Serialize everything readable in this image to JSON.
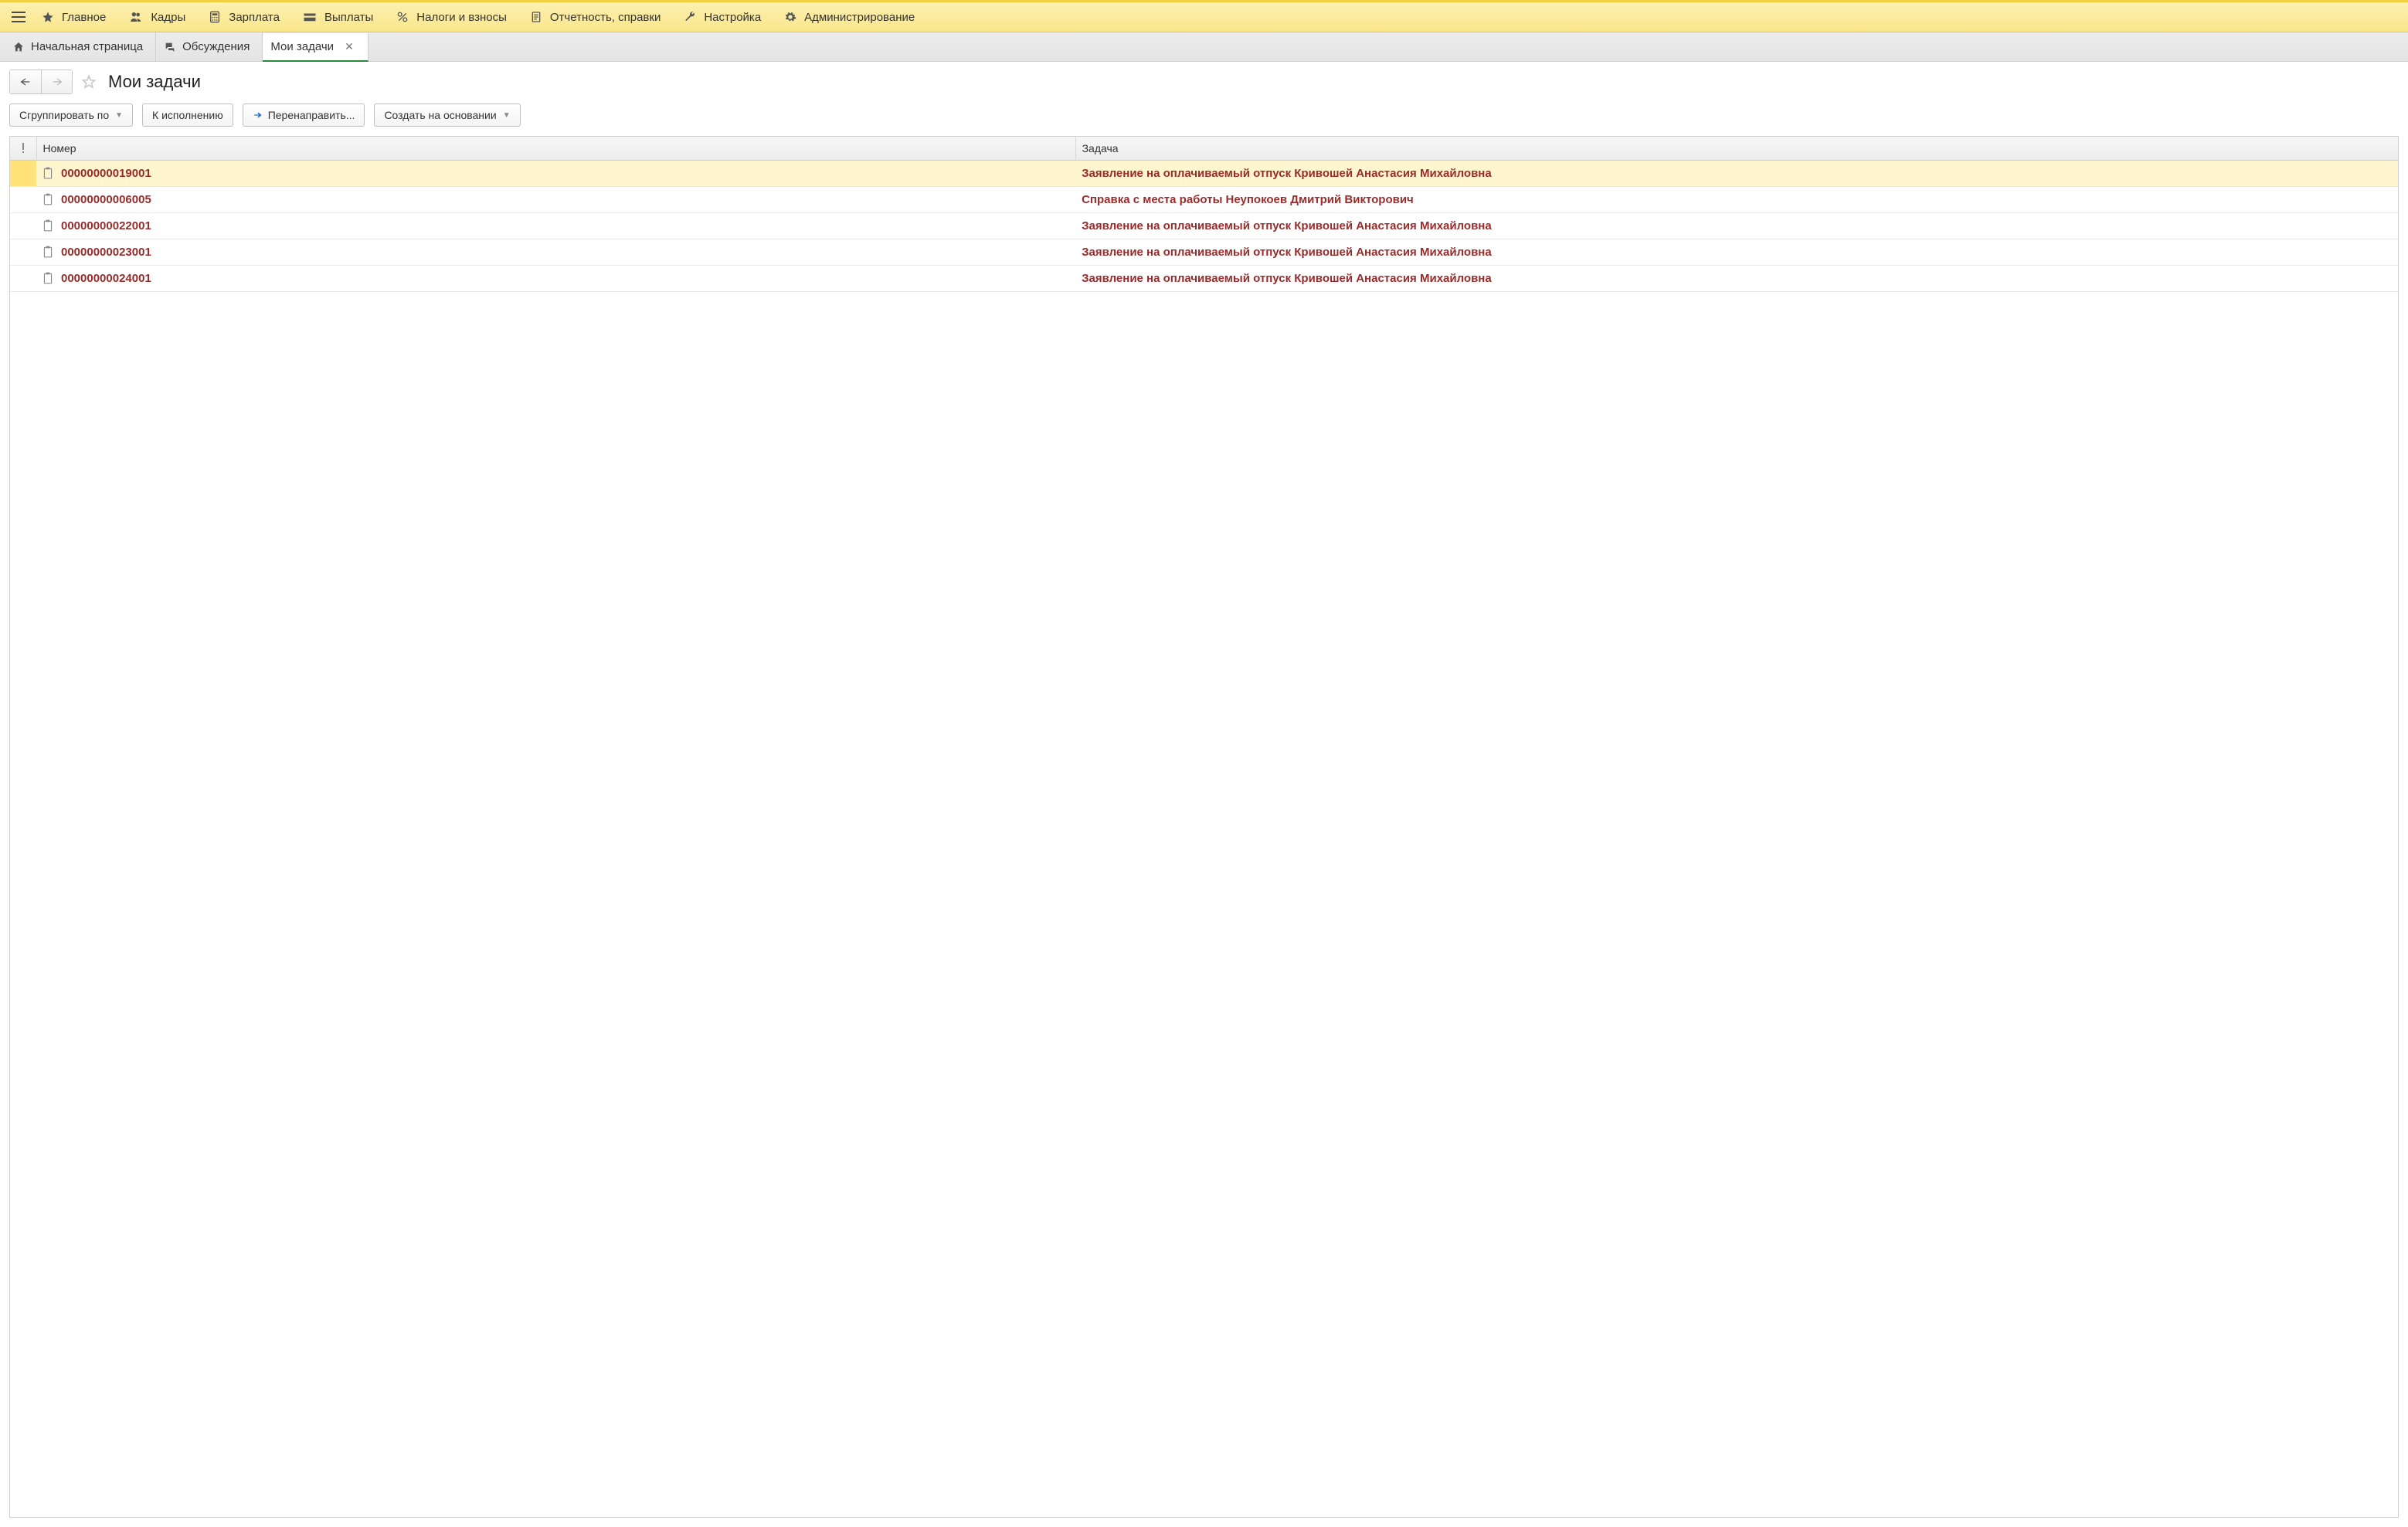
{
  "main_menu": {
    "items": [
      {
        "label": "Главное",
        "icon": "star"
      },
      {
        "label": "Кадры",
        "icon": "people"
      },
      {
        "label": "Зарплата",
        "icon": "calc"
      },
      {
        "label": "Выплаты",
        "icon": "wallet"
      },
      {
        "label": "Налоги и взносы",
        "icon": "percent"
      },
      {
        "label": "Отчетность, справки",
        "icon": "report"
      },
      {
        "label": "Настройка",
        "icon": "wrench"
      },
      {
        "label": "Администрирование",
        "icon": "gear"
      }
    ]
  },
  "tabs": [
    {
      "label": "Начальная страница",
      "icon": "home",
      "active": false,
      "closable": false
    },
    {
      "label": "Обсуждения",
      "icon": "discuss",
      "active": false,
      "closable": false
    },
    {
      "label": "Мои задачи",
      "icon": "",
      "active": true,
      "closable": true
    }
  ],
  "page": {
    "title": "Мои задачи"
  },
  "toolbar": {
    "group_by": "Сгруппировать по",
    "to_execute": "К исполнению",
    "redirect": "Перенаправить...",
    "create_based": "Создать на основании"
  },
  "table": {
    "columns": {
      "number": "Номер",
      "task": "Задача"
    },
    "rows": [
      {
        "number": "00000000019001",
        "task": "Заявление на оплачиваемый отпуск Кривошей Анастасия Михайловна",
        "selected": true
      },
      {
        "number": "00000000006005",
        "task": "Справка с места работы Неупокоев Дмитрий Викторович",
        "selected": false
      },
      {
        "number": "00000000022001",
        "task": "Заявление на оплачиваемый отпуск Кривошей Анастасия Михайловна",
        "selected": false
      },
      {
        "number": "00000000023001",
        "task": "Заявление на оплачиваемый отпуск Кривошей Анастасия Михайловна",
        "selected": false
      },
      {
        "number": "00000000024001",
        "task": "Заявление на оплачиваемый отпуск Кривошей Анастасия Михайловна",
        "selected": false
      }
    ]
  }
}
